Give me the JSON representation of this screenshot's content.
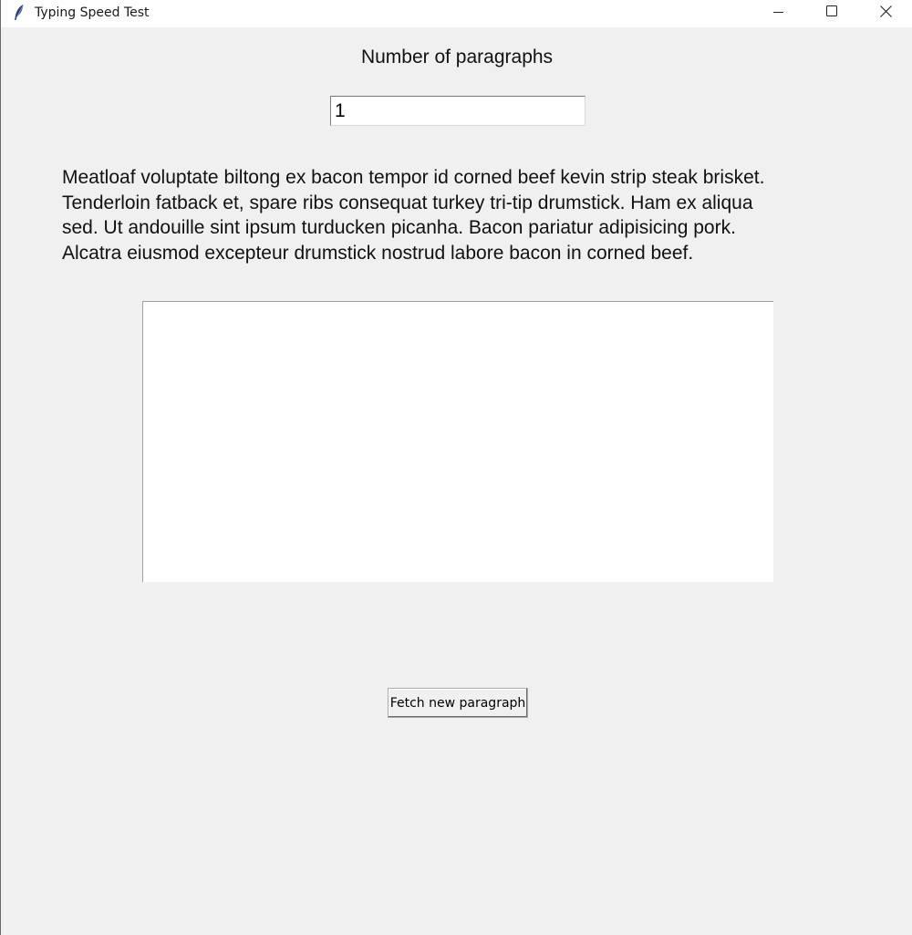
{
  "window": {
    "title": "Typing Speed Test",
    "icon": "feather-icon",
    "controls": {
      "minimize_icon": "minimize-icon",
      "maximize_icon": "maximize-icon",
      "close_icon": "close-icon"
    }
  },
  "main": {
    "paragraph_count_label": "Number of paragraphs",
    "paragraph_count_value": "1",
    "sample_paragraph": "Meatloaf voluptate biltong ex bacon tempor id corned beef kevin strip steak brisket.\nTenderloin fatback et, spare ribs consequat turkey tri-tip drumstick.  Ham ex aliqua\nsed.  Ut andouille sint ipsum turducken picanha.  Bacon pariatur adipisicing pork.\nAlcatra eiusmod excepteur drumstick nostrud labore bacon in corned beef.",
    "typing_area_value": "",
    "fetch_button_label": "Fetch new paragraph"
  },
  "colors": {
    "background": "#f0f0f0",
    "titlebar": "#ffffff",
    "input_background": "#ffffff"
  }
}
